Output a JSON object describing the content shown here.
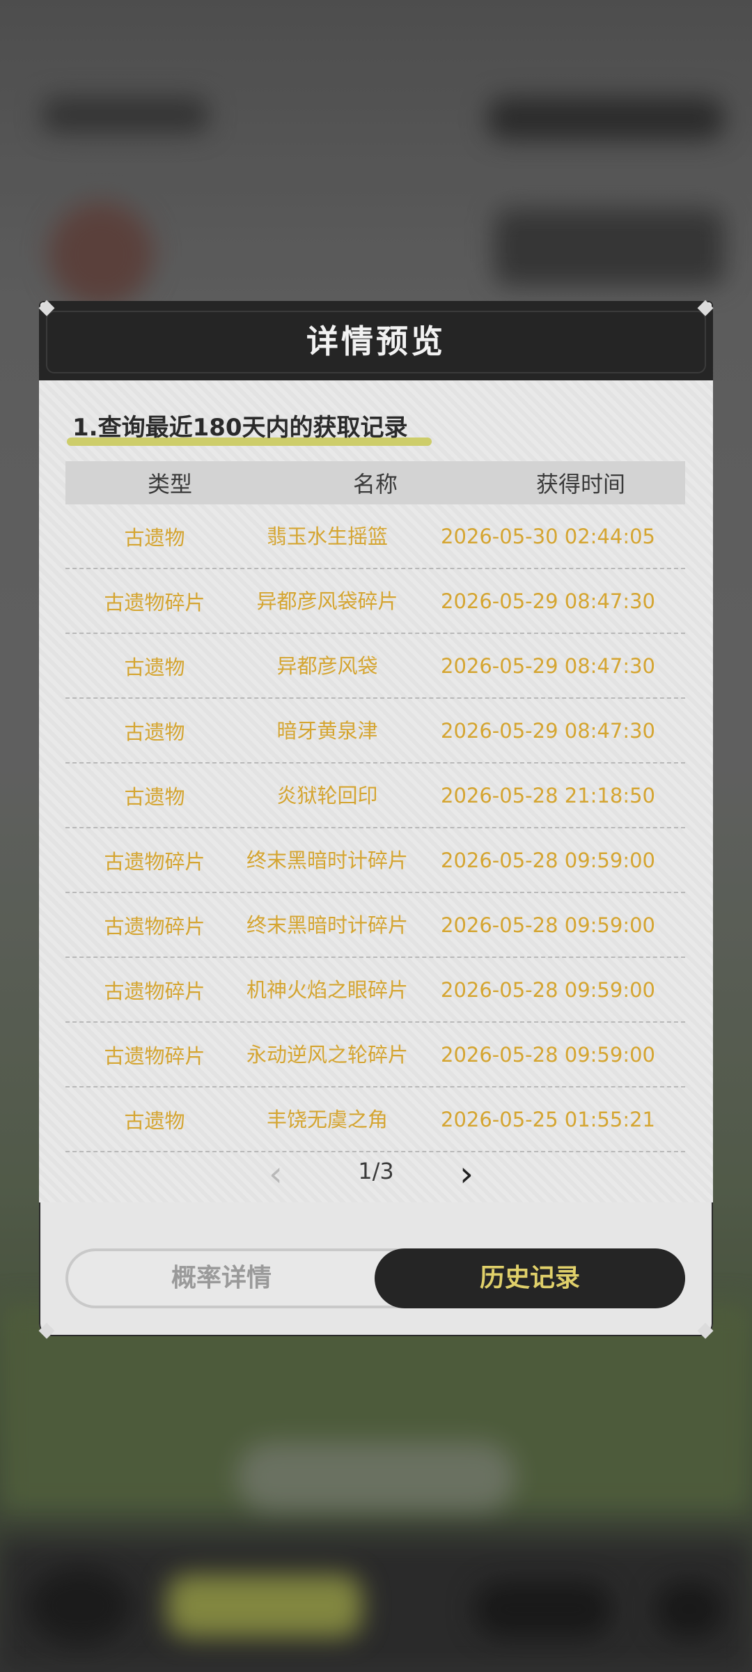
{
  "modal": {
    "title": "详情预览",
    "section_title": "1.查询最近180天内的获取记录"
  },
  "table": {
    "headers": [
      "类型",
      "名称",
      "获得时间"
    ],
    "rows": [
      {
        "type": "古遗物",
        "name": "翡玉水生摇篮",
        "time": "2026-05-30 02:44:05"
      },
      {
        "type": "古遗物碎片",
        "name": "异都彦风袋碎片",
        "time": "2026-05-29 08:47:30"
      },
      {
        "type": "古遗物",
        "name": "异都彦风袋",
        "time": "2026-05-29 08:47:30"
      },
      {
        "type": "古遗物",
        "name": "暗牙黄泉津",
        "time": "2026-05-29 08:47:30"
      },
      {
        "type": "古遗物",
        "name": "炎狱轮回印",
        "time": "2026-05-28 21:18:50"
      },
      {
        "type": "古遗物碎片",
        "name": "终末黑暗时计碎片",
        "time": "2026-05-28 09:59:00"
      },
      {
        "type": "古遗物碎片",
        "name": "终末黑暗时计碎片",
        "time": "2026-05-28 09:59:00"
      },
      {
        "type": "古遗物碎片",
        "name": "机神火焰之眼碎片",
        "time": "2026-05-28 09:59:00"
      },
      {
        "type": "古遗物碎片",
        "name": "永动逆风之轮碎片",
        "time": "2026-05-28 09:59:00"
      },
      {
        "type": "古遗物",
        "name": "丰饶无虞之角",
        "time": "2026-05-25 01:55:21"
      }
    ]
  },
  "pager": {
    "page_text": "1/3",
    "prev_icon": "chevron-left-icon",
    "next_icon": "chevron-right-icon"
  },
  "tabs": {
    "probability_label": "概率详情",
    "history_label": "历史记录",
    "active": "history"
  },
  "colors": {
    "row_text": "#d5a531",
    "header_bg": "#252525",
    "active_tab_text": "#e0d06a"
  }
}
